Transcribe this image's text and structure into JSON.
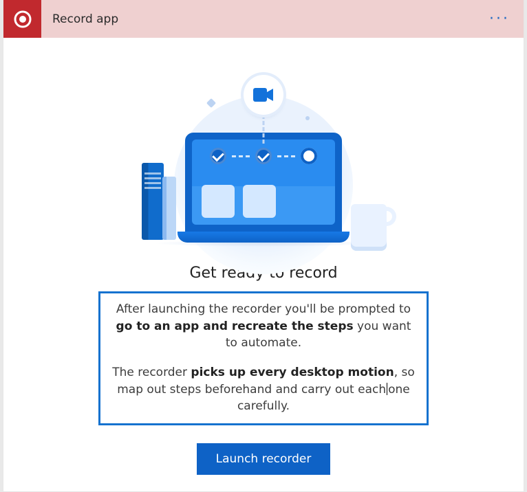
{
  "header": {
    "title": "Record app",
    "record_icon": "record-icon",
    "more_options": "···"
  },
  "illustration": {
    "camera_icon": "camera-icon"
  },
  "heading": "Get ready to record",
  "info": {
    "p1_a": "After launching the recorder you'll be prompted to ",
    "p1_b": "go to an app and recreate the steps",
    "p1_c": " you want to automate.",
    "p2_a": "The recorder ",
    "p2_b": "picks up every desktop motion",
    "p2_c": ", so map out steps beforehand and carry out each",
    "p2_d": "one carefully."
  },
  "cta_label": "Launch recorder",
  "colors": {
    "accent": "#0e62c6",
    "header_bg": "#efd0d0",
    "badge": "#c1292e",
    "highlight_border": "#1572cf"
  }
}
